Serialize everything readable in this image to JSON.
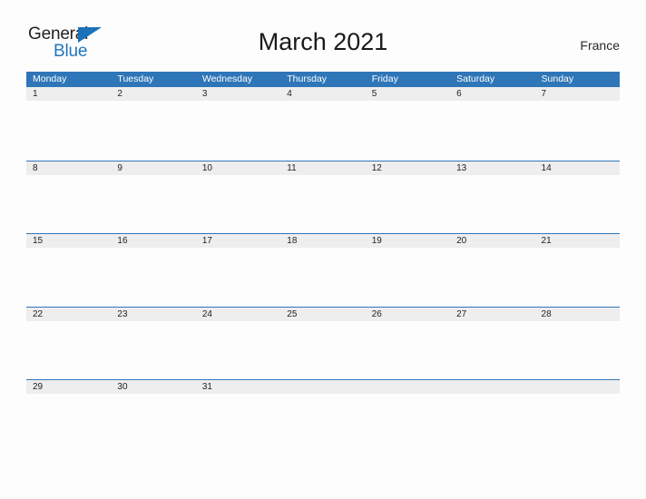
{
  "brand": {
    "name_part1": "General",
    "name_part2": "Blue",
    "triangle_icon": "triangle-right-icon",
    "colors": {
      "dark": "#231f20",
      "blue": "#2176bd"
    }
  },
  "header": {
    "title": "March 2021",
    "country": "France"
  },
  "calendar": {
    "accent_color": "#2e76b8",
    "date_band_color": "#eeeeee",
    "weekdays": [
      "Monday",
      "Tuesday",
      "Wednesday",
      "Thursday",
      "Friday",
      "Saturday",
      "Sunday"
    ],
    "weeks": [
      {
        "days": [
          "1",
          "2",
          "3",
          "4",
          "5",
          "6",
          "7"
        ]
      },
      {
        "days": [
          "8",
          "9",
          "10",
          "11",
          "12",
          "13",
          "14"
        ]
      },
      {
        "days": [
          "15",
          "16",
          "17",
          "18",
          "19",
          "20",
          "21"
        ]
      },
      {
        "days": [
          "22",
          "23",
          "24",
          "25",
          "26",
          "27",
          "28"
        ]
      },
      {
        "days": [
          "29",
          "30",
          "31",
          "",
          "",
          "",
          ""
        ]
      }
    ]
  }
}
